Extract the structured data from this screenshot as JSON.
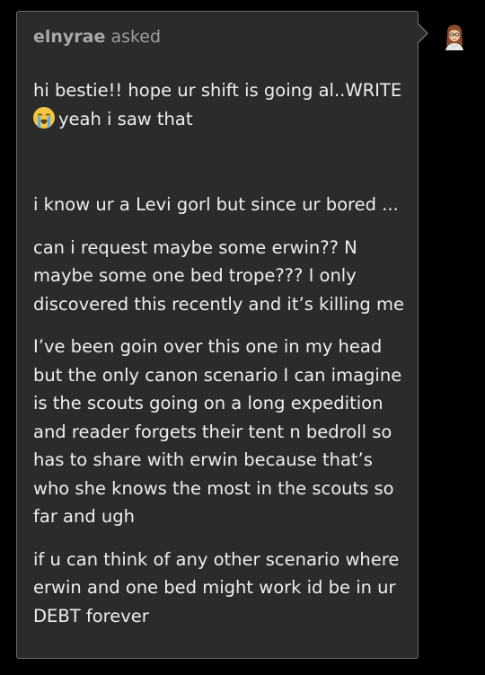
{
  "ask": {
    "asker_name": "elnyrae",
    "asked_label": "asked",
    "paragraphs": {
      "p1_line1": "hi bestie!! hope ur shift is going al..WRITE",
      "p1_line2": "yeah i saw that",
      "p2": "i know ur a Levi gorl but since ur bored ...",
      "p3": "can i request maybe some erwin?? N maybe some one bed trope??? I only discovered this recently and it’s killing me",
      "p4": "I’ve been goin over this one in my head but the only canon scenario I can imagine is the scouts going on a long expedition and reader forgets their tent n bedroll so has to share with erwin because that’s who she knows the most in the scouts so far and ugh",
      "p5": "if u can think of any other scenario where erwin and one bed might work id be in ur DEBT forever"
    },
    "emoji_icon": "loudly-crying-face-icon"
  },
  "avatar_icon": "user-avatar-icon",
  "colors": {
    "background": "#000000",
    "card": "#2b2b2b",
    "card_border": "#6c6c6c",
    "body_text": "#eeeeee",
    "meta_text": "#9d9d9d"
  }
}
